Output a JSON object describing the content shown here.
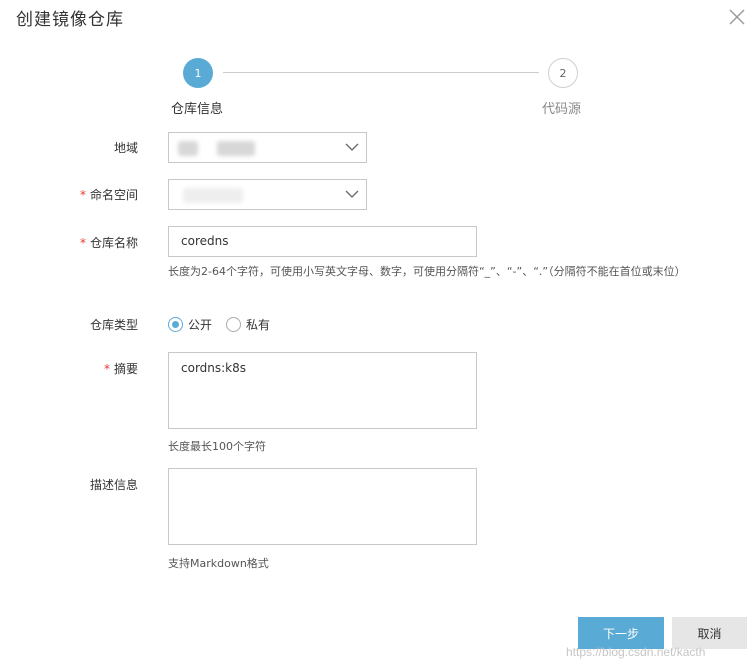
{
  "dialog": {
    "title": "创建镜像仓库"
  },
  "steps": [
    {
      "number": "1",
      "label": "仓库信息",
      "active": true
    },
    {
      "number": "2",
      "label": "代码源",
      "active": false
    }
  ],
  "form": {
    "region": {
      "label": "地域",
      "value": ""
    },
    "namespace": {
      "label": "命名空间",
      "required_mark": "*",
      "value": ""
    },
    "repo_name": {
      "label": "仓库名称",
      "required_mark": "*",
      "value": "coredns",
      "hint": "长度为2-64个字符，可使用小写英文字母、数字，可使用分隔符“_”、“-”、“.”（分隔符不能在首位或末位）"
    },
    "repo_type": {
      "label": "仓库类型",
      "options": [
        {
          "label": "公开",
          "checked": true
        },
        {
          "label": "私有",
          "checked": false
        }
      ]
    },
    "summary": {
      "label": "摘要",
      "required_mark": "*",
      "value": "cordns:k8s",
      "hint": "长度最长100个字符"
    },
    "description": {
      "label": "描述信息",
      "value": "",
      "hint": "支持Markdown格式"
    }
  },
  "buttons": {
    "next": "下一步",
    "cancel": "取消"
  },
  "watermark": "https://blog.csdn.net/kacth",
  "icons": {
    "close": "close-icon",
    "dropdown": "chevron-down-icon"
  },
  "colors": {
    "accent": "#5aaad6",
    "required": "#e4393c",
    "cancel_bg": "#e6e6e6"
  }
}
